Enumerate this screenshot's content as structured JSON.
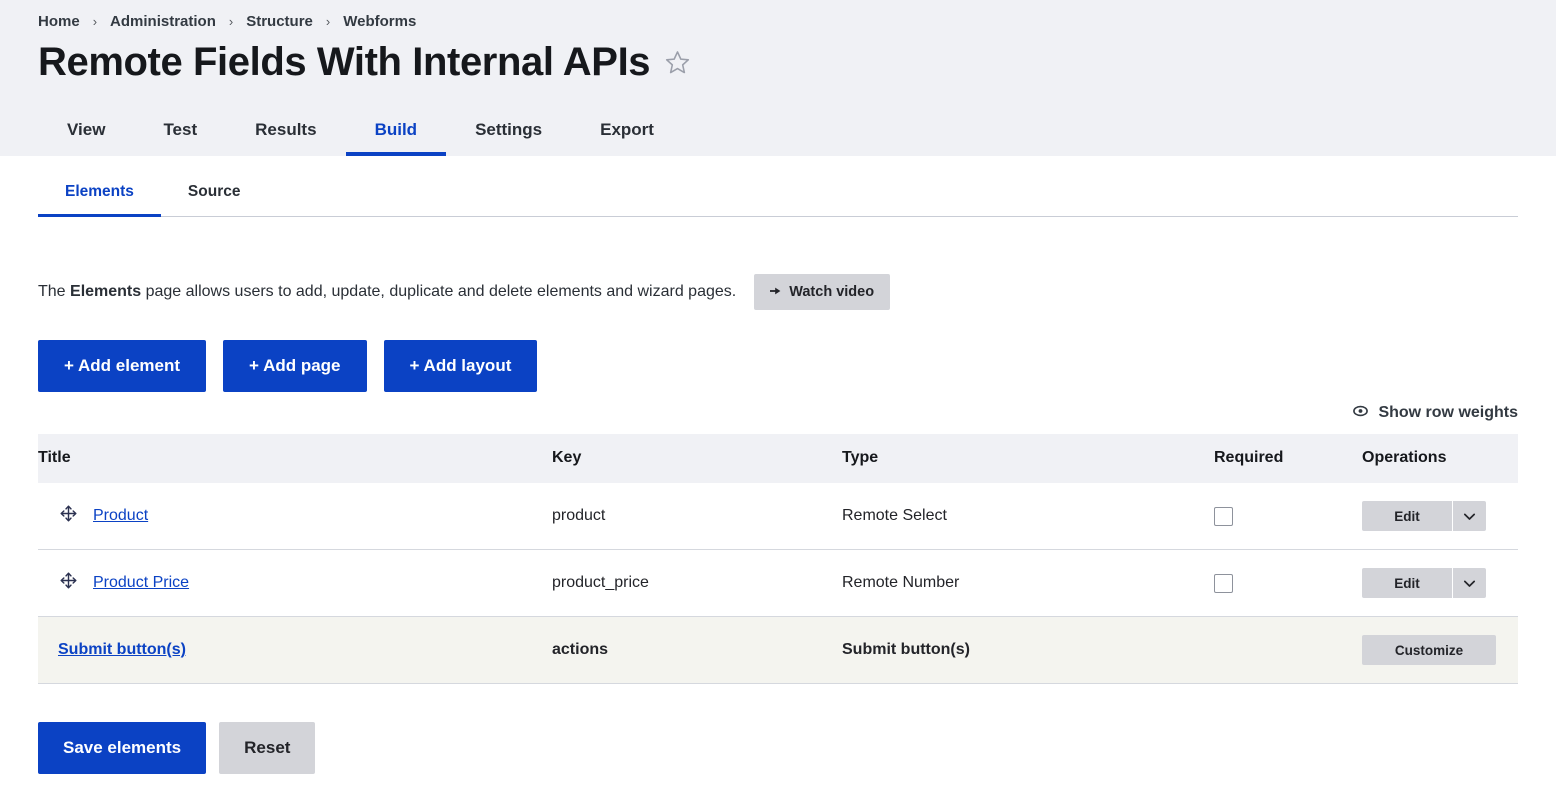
{
  "breadcrumb": {
    "separator": "›",
    "items": [
      {
        "label": "Home"
      },
      {
        "label": "Administration"
      },
      {
        "label": "Structure"
      },
      {
        "label": "Webforms"
      }
    ]
  },
  "page": {
    "title": "Remote Fields With Internal APIs",
    "favorite_icon": "star-outline-icon"
  },
  "primary_tabs": [
    {
      "label": "View",
      "active": false
    },
    {
      "label": "Test",
      "active": false
    },
    {
      "label": "Results",
      "active": false
    },
    {
      "label": "Build",
      "active": true
    },
    {
      "label": "Settings",
      "active": false
    },
    {
      "label": "Export",
      "active": false
    }
  ],
  "secondary_tabs": [
    {
      "label": "Elements",
      "active": true
    },
    {
      "label": "Source",
      "active": false
    }
  ],
  "help": {
    "text_before": "The ",
    "text_bold": "Elements",
    "text_after": " page allows users to add, update, duplicate and delete elements and wizard pages.",
    "watch_video_label": "Watch video",
    "watch_video_icon": "play-icon"
  },
  "actions": {
    "add_element": "+ Add element",
    "add_page": "+ Add page",
    "add_layout": "+ Add layout"
  },
  "row_weights": {
    "label": "Show row weights",
    "icon": "eye-icon"
  },
  "table": {
    "columns": [
      "Title",
      "Key",
      "Type",
      "Required",
      "Operations"
    ],
    "rows": [
      {
        "title": "Product",
        "key": "product",
        "type": "Remote Select",
        "required": false,
        "operation_label": "Edit",
        "has_drag_handle": true,
        "is_submit_row": false
      },
      {
        "title": "Product Price",
        "key": "product_price",
        "type": "Remote Number",
        "required": false,
        "operation_label": "Edit",
        "has_drag_handle": true,
        "is_submit_row": false
      },
      {
        "title": "Submit button(s)",
        "key": "actions",
        "type": "Submit button(s)",
        "required": null,
        "operation_label": "Customize",
        "has_drag_handle": false,
        "is_submit_row": true
      }
    ]
  },
  "footer": {
    "save_label": "Save elements",
    "reset_label": "Reset"
  },
  "colors": {
    "accent": "#0b42c4",
    "header_band": "#f0f1f5",
    "button_gray": "#d3d4d9",
    "submit_row_bg": "#f4f4ef"
  }
}
